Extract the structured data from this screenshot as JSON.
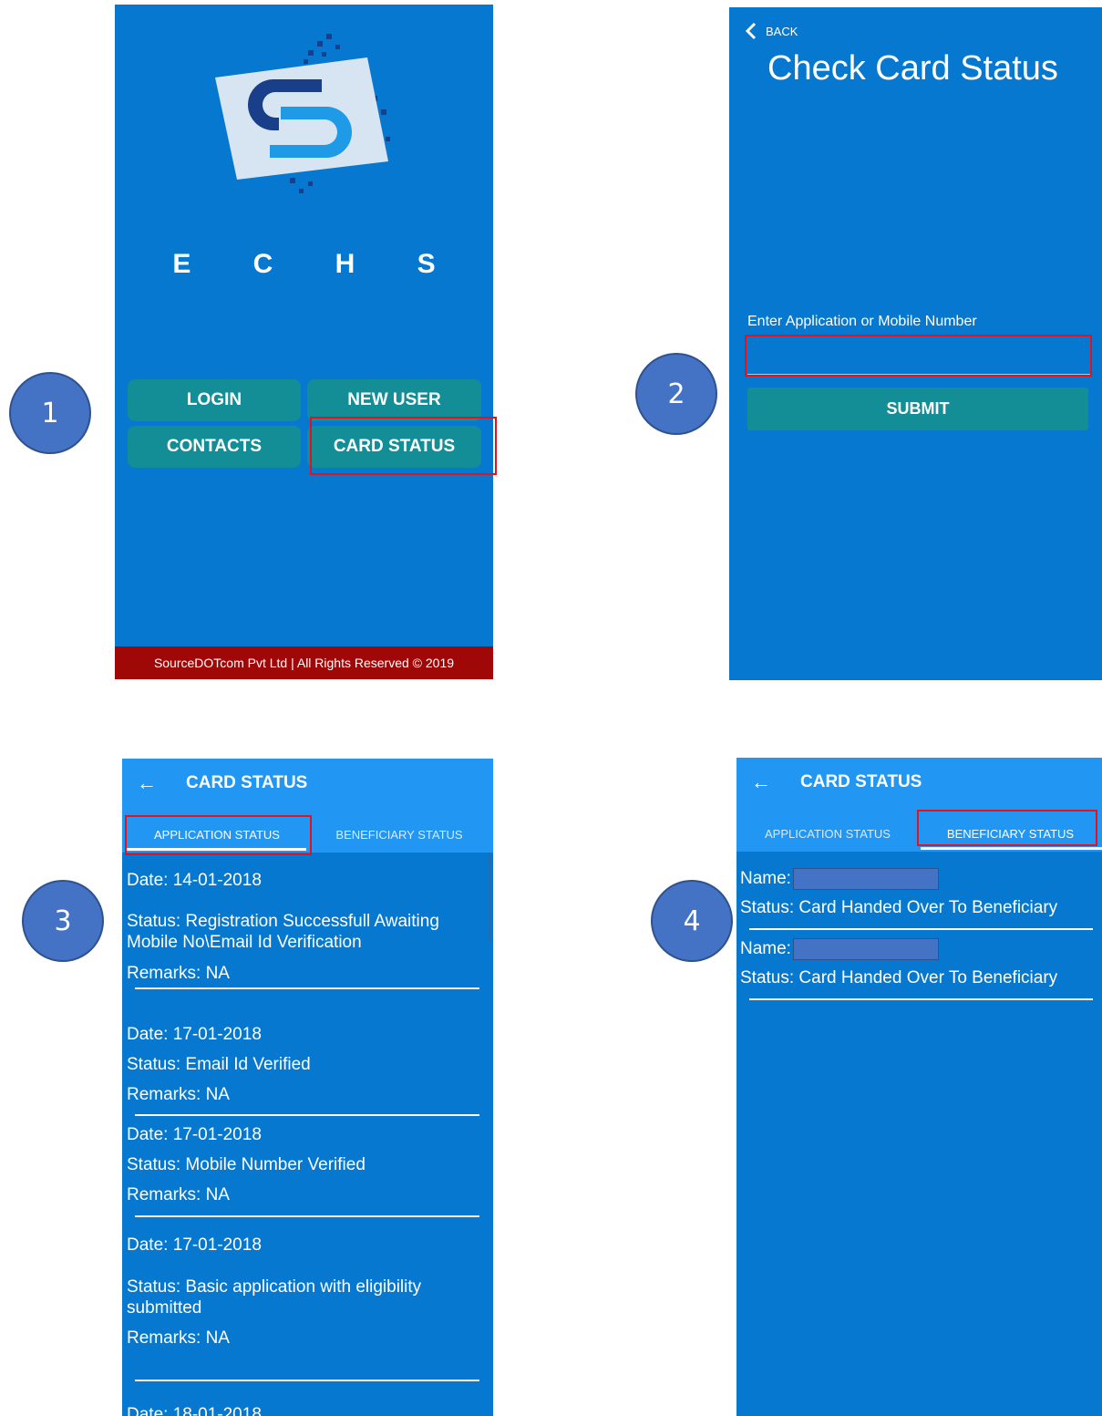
{
  "steps": [
    "1",
    "2",
    "3",
    "4"
  ],
  "screen1": {
    "app_name": "E C H S",
    "buttons": {
      "login": "LOGIN",
      "new_user": "NEW USER",
      "contacts": "CONTACTS",
      "card_status": "CARD STATUS"
    },
    "footer": "SourceDOTcom Pvt Ltd | All Rights Reserved © 2019",
    "colors": {
      "background": "#0678d0",
      "button": "#138e97",
      "footer": "#a00808"
    }
  },
  "screen2": {
    "back_label": "BACK",
    "title": "Check Card Status",
    "input_label": "Enter Application or Mobile Number",
    "input_value": "",
    "submit_label": "SUBMIT"
  },
  "screen3": {
    "title": "CARD STATUS",
    "tabs": [
      "APPLICATION STATUS",
      "BENEFICIARY STATUS"
    ],
    "active_tab": "APPLICATION STATUS",
    "entries": [
      {
        "date": "Date: 14-01-2018",
        "status": "Status: Registration Successfull Awaiting Mobile No\\Email Id Verification",
        "remarks": "Remarks: NA"
      },
      {
        "date": "Date: 17-01-2018",
        "status": "Status: Email Id Verified",
        "remarks": "Remarks: NA"
      },
      {
        "date": "Date: 17-01-2018",
        "status": "Status: Mobile Number Verified",
        "remarks": "Remarks: NA"
      },
      {
        "date": "Date: 17-01-2018",
        "status": "Status: Basic application with eligibility submitted",
        "remarks": "Remarks: NA"
      },
      {
        "date": "Date: 18-01-2018"
      }
    ]
  },
  "screen4": {
    "title": "CARD STATUS",
    "tabs": [
      "APPLICATION STATUS",
      "BENEFICIARY STATUS"
    ],
    "active_tab": "BENEFICIARY STATUS",
    "entries": [
      {
        "name_label": "Name:",
        "status": "Status: Card Handed Over To Beneficiary"
      },
      {
        "name_label": "Name:",
        "status": "Status: Card Handed Over To Beneficiary"
      }
    ]
  },
  "icons": [
    "logo-icon",
    "back-chevron-icon",
    "back-arrow-icon"
  ]
}
